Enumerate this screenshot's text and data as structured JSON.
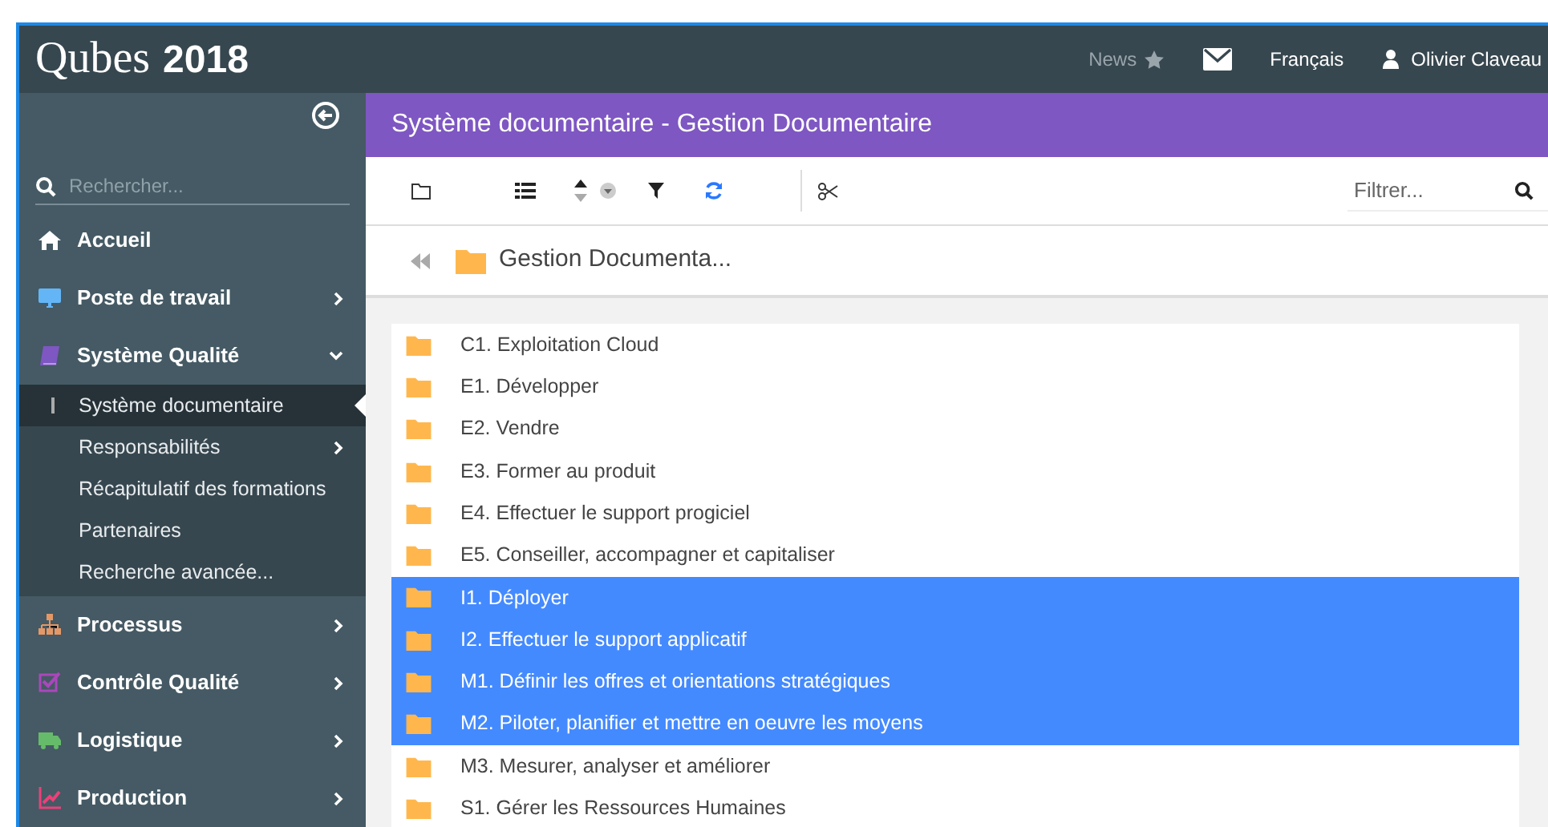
{
  "header": {
    "logo": "Qubes",
    "year": "2018",
    "news": "News",
    "language": "Français",
    "user": "Olivier Claveau"
  },
  "sidebar": {
    "search_placeholder": "Rechercher...",
    "items": [
      {
        "label": "Accueil",
        "has_children": false
      },
      {
        "label": "Poste de travail",
        "has_children": true,
        "expanded": false
      },
      {
        "label": "Système Qualité",
        "has_children": true,
        "expanded": true,
        "children": [
          {
            "label": "Système documentaire",
            "selected": true,
            "has_children": false
          },
          {
            "label": "Responsabilités",
            "selected": false,
            "has_children": true
          },
          {
            "label": "Récapitulatif des formations",
            "selected": false,
            "has_children": false
          },
          {
            "label": "Partenaires",
            "selected": false,
            "has_children": false
          },
          {
            "label": "Recherche avancée...",
            "selected": false,
            "has_children": false
          }
        ]
      },
      {
        "label": "Processus",
        "has_children": true,
        "expanded": false
      },
      {
        "label": "Contrôle Qualité",
        "has_children": true,
        "expanded": false
      },
      {
        "label": "Logistique",
        "has_children": true,
        "expanded": false
      },
      {
        "label": "Production",
        "has_children": true,
        "expanded": false
      }
    ]
  },
  "page_title": "Système documentaire - Gestion Documentaire",
  "toolbar": {
    "filter_placeholder": "Filtrer..."
  },
  "breadcrumb": "Gestion Documenta...",
  "folders": [
    {
      "label": "C1. Exploitation Cloud",
      "selected": false
    },
    {
      "label": "E1. Développer",
      "selected": false
    },
    {
      "label": "E2. Vendre",
      "selected": false
    },
    {
      "label": "E3. Former au produit",
      "selected": false
    },
    {
      "label": "E4. Effectuer le support progiciel",
      "selected": false
    },
    {
      "label": "E5. Conseiller, accompagner et capitaliser",
      "selected": false
    },
    {
      "label": "I1. Déployer",
      "selected": true
    },
    {
      "label": "I2. Effectuer le support applicatif",
      "selected": true
    },
    {
      "label": "M1. Définir les offres et orientations stratégiques",
      "selected": true
    },
    {
      "label": "M2. Piloter, planifier et mettre en oeuvre les moyens",
      "selected": true
    },
    {
      "label": "M3. Mesurer, analyser et améliorer",
      "selected": false
    },
    {
      "label": "S1. Gérer les Ressources Humaines",
      "selected": false
    }
  ]
}
